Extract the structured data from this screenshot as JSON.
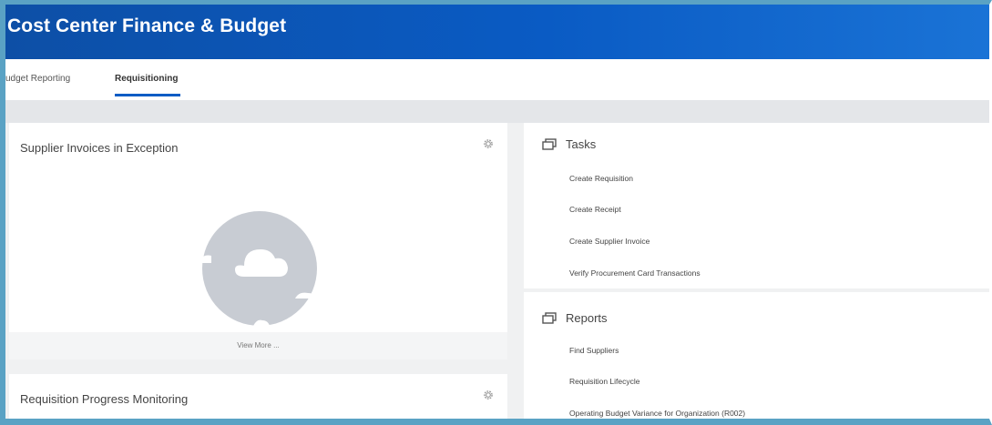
{
  "header": {
    "title": "Cost Center Finance & Budget"
  },
  "tabs": [
    {
      "label": "udget Reporting",
      "active": false
    },
    {
      "label": "Requisitioning",
      "active": true
    }
  ],
  "cards": {
    "supplier_invoices": {
      "title": "Supplier Invoices in Exception",
      "view_more": "View More ..."
    },
    "requisition_progress": {
      "title": "Requisition Progress Monitoring"
    }
  },
  "tasks": {
    "title": "Tasks",
    "items": [
      "Create Requisition",
      "Create Receipt",
      "Create Supplier Invoice",
      "Verify Procurement Card Transactions"
    ]
  },
  "reports": {
    "title": "Reports",
    "items": [
      "Find Suppliers",
      "Requisition Lifecycle",
      "Operating Budget Variance for Organization (R002)"
    ]
  },
  "colors": {
    "header_blue": "#0b5cc5",
    "frame": "#5aa2c4",
    "tab_underline": "#0b5cc5"
  },
  "icons": [
    "gear-icon",
    "cloud-icon",
    "window-stack-icon"
  ]
}
